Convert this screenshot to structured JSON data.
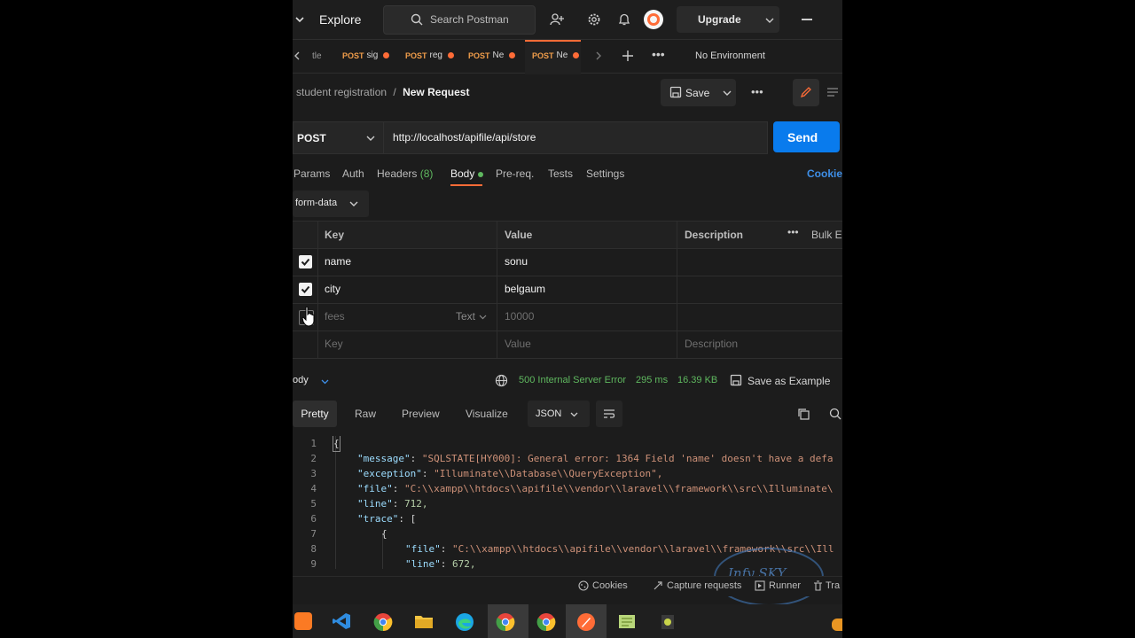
{
  "header": {
    "explore": "Explore",
    "search_placeholder": "Search Postman",
    "upgrade": "Upgrade"
  },
  "tabs": [
    {
      "method": "",
      "name": "tle"
    },
    {
      "method": "POST",
      "name": "sig"
    },
    {
      "method": "POST",
      "name": "reg"
    },
    {
      "method": "POST",
      "name": "Ne"
    },
    {
      "method": "POST",
      "name": "Ne"
    }
  ],
  "environment": "No Environment",
  "breadcrumb": {
    "collection": "student registration",
    "separator": "/",
    "request": "New Request"
  },
  "save_label": "Save",
  "request": {
    "method": "POST",
    "url": "http://localhost/apifile/api/store",
    "send_label": "Send"
  },
  "request_tabs": {
    "params": "Params",
    "auth": "Auth",
    "headers": "Headers",
    "headers_count": "(8)",
    "body": "Body",
    "prereq": "Pre-req.",
    "tests": "Tests",
    "settings": "Settings",
    "cookies": "Cookie"
  },
  "body_type": "form-data",
  "table": {
    "col_key": "Key",
    "col_value": "Value",
    "col_description": "Description",
    "bulk_edit": "Bulk E",
    "rows": [
      {
        "key": "name",
        "value": "sonu",
        "checked": true
      },
      {
        "key": "city",
        "value": "belgaum",
        "checked": true
      },
      {
        "key": "fees",
        "value": "10000",
        "type": "Text",
        "checked": false
      }
    ],
    "placeholder_key": "Key",
    "placeholder_value": "Value",
    "placeholder_description": "Description"
  },
  "response": {
    "label": "ody",
    "status": "500 Internal Server Error",
    "time": "295 ms",
    "size": "16.39 KB",
    "save_example": "Save as Example",
    "tabs": {
      "pretty": "Pretty",
      "raw": "Raw",
      "preview": "Preview",
      "visualize": "Visualize"
    },
    "format": "JSON"
  },
  "code_lines": [
    {
      "num": "1",
      "text": "{"
    },
    {
      "num": "2",
      "key": "\"message\"",
      "val": "\"SQLSTATE[HY000]: General error: 1364 Field 'name' doesn't have a defa"
    },
    {
      "num": "3",
      "key": "\"exception\"",
      "val": "\"Illuminate\\\\Database\\\\QueryException\","
    },
    {
      "num": "4",
      "key": "\"file\"",
      "val": "\"C:\\\\xampp\\\\htdocs\\\\apifile\\\\vendor\\\\laravel\\\\framework\\\\src\\\\Illuminate\\"
    },
    {
      "num": "5",
      "key": "\"line\"",
      "val": "712,"
    },
    {
      "num": "6",
      "key": "\"trace\"",
      "val": "["
    },
    {
      "num": "7",
      "text": "{"
    },
    {
      "num": "8",
      "key": "\"file\"",
      "val": "\"C:\\\\xampp\\\\htdocs\\\\apifile\\\\vendor\\\\laravel\\\\framework\\\\src\\\\Ill"
    },
    {
      "num": "9",
      "key": "\"line\"",
      "val": "672,"
    }
  ],
  "footer": {
    "cookies": "Cookies",
    "capture": "Capture requests",
    "runner": "Runner",
    "trash": "Tra"
  },
  "watermark": "Infy SKY",
  "colors": {
    "accent": "#ff6c37",
    "send": "#097bed",
    "status_error": "#5fb85f",
    "background": "#1c1c1c"
  }
}
